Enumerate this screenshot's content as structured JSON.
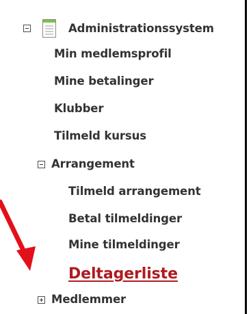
{
  "tree": {
    "root": {
      "label": "Administrationssystem",
      "icon": "document-icon",
      "state": "expanded"
    },
    "items": [
      {
        "label": "Min medlemsprofil"
      },
      {
        "label": "Mine betalinger"
      },
      {
        "label": "Klubber"
      },
      {
        "label": "Tilmeld kursus"
      }
    ],
    "arrangement": {
      "label": "Arrangement",
      "state": "expanded",
      "children": [
        {
          "label": "Tilmeld arrangement"
        },
        {
          "label": "Betal tilmeldinger"
        },
        {
          "label": "Mine tilmeldinger"
        },
        {
          "label": "Deltagerliste",
          "highlighted": true
        }
      ]
    },
    "medlemmer": {
      "label": "Medlemmer",
      "state": "collapsed"
    }
  },
  "colors": {
    "text": "#333333",
    "highlight": "#b01a1f",
    "arrow": "#e3101a",
    "icon_green": "#7cc04b",
    "border": "#000000"
  }
}
